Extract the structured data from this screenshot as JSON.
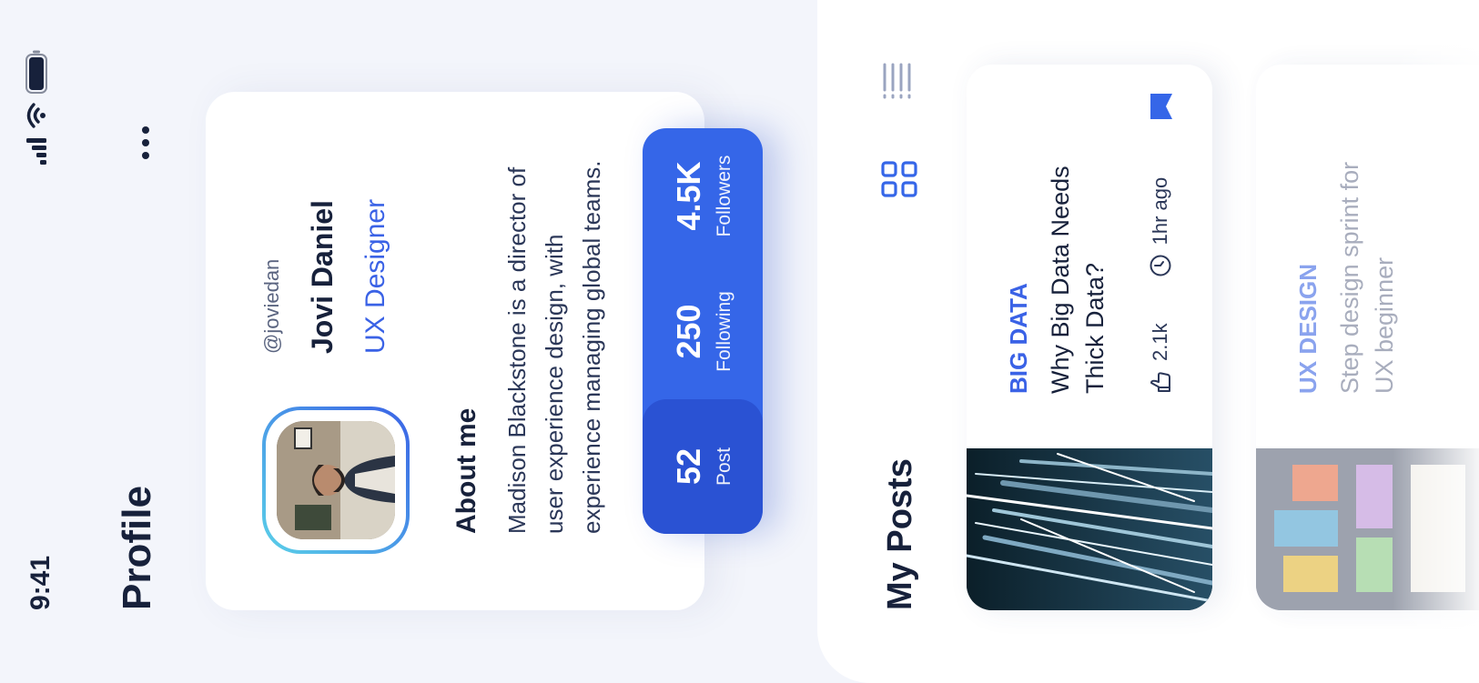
{
  "status_bar": {
    "time": "9:41"
  },
  "header": {
    "title": "Profile"
  },
  "profile": {
    "handle": "@joviedan",
    "name": "Jovi Daniel",
    "role": "UX Designer",
    "about_title": "About me",
    "about_text": "Madison Blackstone is a director of user experience design, with experience managing global teams."
  },
  "stats": [
    {
      "value": "52",
      "label": "Post"
    },
    {
      "value": "250",
      "label": "Following"
    },
    {
      "value": "4.5K",
      "label": "Followers"
    }
  ],
  "posts_section": {
    "title": "My Posts",
    "posts": [
      {
        "category": "BIG DATA",
        "title": "Why Big Data Needs Thick Data?",
        "likes": "2.1k",
        "time": "1hr ago"
      },
      {
        "category": "UX DESIGN",
        "title": "Step design sprint for UX beginner"
      }
    ]
  },
  "colors": {
    "accent": "#3566e8",
    "dark": "#17213b",
    "background": "#f3f5fb"
  },
  "icons": [
    "battery-icon",
    "wifi-icon",
    "signal-icon",
    "more-icon",
    "grid-view-icon",
    "list-view-icon",
    "like-icon",
    "clock-icon",
    "bookmark-icon"
  ]
}
